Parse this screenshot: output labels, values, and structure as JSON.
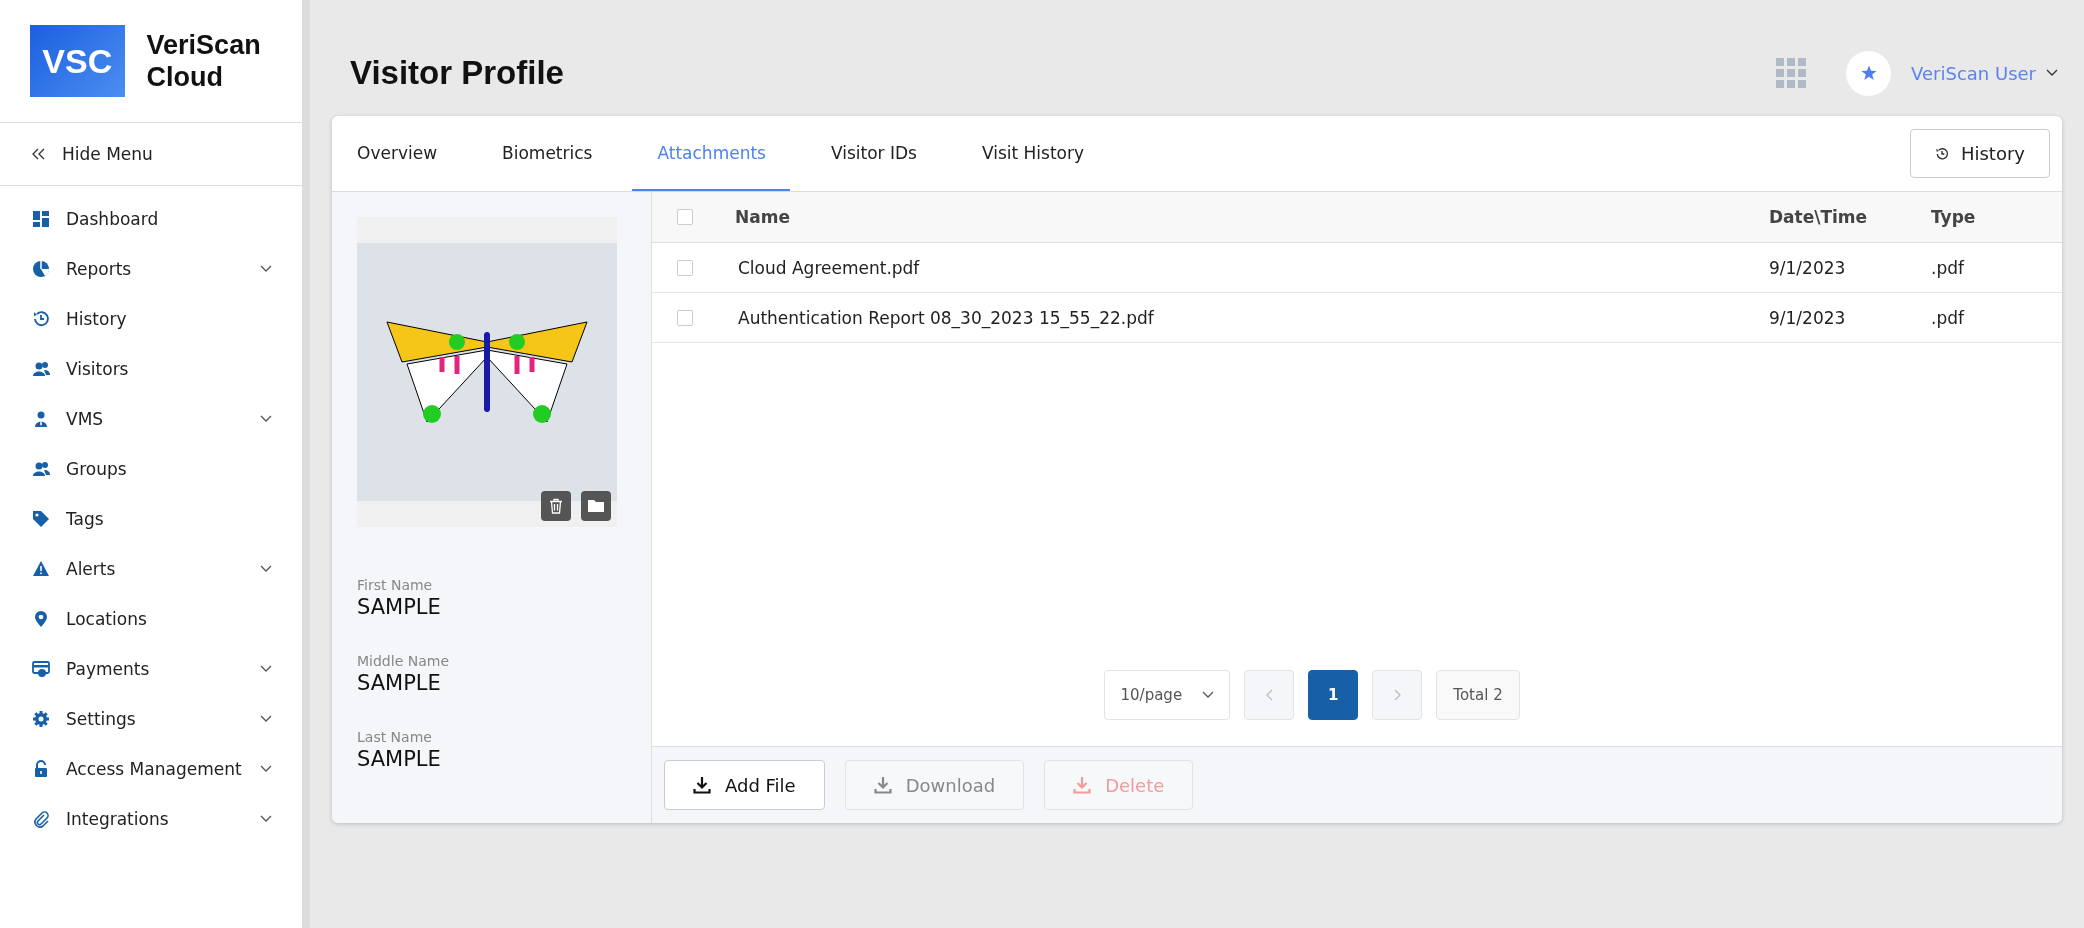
{
  "logo": {
    "mark": "VSC",
    "name": "VeriScan Cloud"
  },
  "sidebar": {
    "hide_menu": "Hide Menu",
    "items": [
      {
        "label": "Dashboard",
        "expandable": false
      },
      {
        "label": "Reports",
        "expandable": true
      },
      {
        "label": "History",
        "expandable": false
      },
      {
        "label": "Visitors",
        "expandable": false
      },
      {
        "label": "VMS",
        "expandable": true
      },
      {
        "label": "Groups",
        "expandable": false
      },
      {
        "label": "Tags",
        "expandable": false
      },
      {
        "label": "Alerts",
        "expandable": true
      },
      {
        "label": "Locations",
        "expandable": false
      },
      {
        "label": "Payments",
        "expandable": true
      },
      {
        "label": "Settings",
        "expandable": true
      },
      {
        "label": "Access Management",
        "expandable": true
      },
      {
        "label": "Integrations",
        "expandable": true
      }
    ]
  },
  "header": {
    "title": "Visitor Profile",
    "user_name": "VeriScan User"
  },
  "tabs": [
    {
      "label": "Overview",
      "selected": false
    },
    {
      "label": "Biometrics",
      "selected": false
    },
    {
      "label": "Attachments",
      "selected": true
    },
    {
      "label": "Visitor IDs",
      "selected": false
    },
    {
      "label": "Visit History",
      "selected": false
    }
  ],
  "history_button": "History",
  "profile": {
    "fields": [
      {
        "label": "First Name",
        "value": "SAMPLE"
      },
      {
        "label": "Middle Name",
        "value": "SAMPLE"
      },
      {
        "label": "Last Name",
        "value": "SAMPLE"
      }
    ]
  },
  "table": {
    "columns": [
      "Name",
      "Date\\Time",
      "Type"
    ],
    "all_checked": false,
    "rows": [
      {
        "name": "Cloud Agreement.pdf",
        "date_time": "9/1/2023",
        "type": ".pdf",
        "checked": false
      },
      {
        "name": "Authentication Report 08_30_2023 15_55_22.pdf",
        "date_time": "9/1/2023",
        "type": ".pdf",
        "checked": false
      }
    ]
  },
  "pagination": {
    "page_size": "10/page",
    "prev_disabled": true,
    "next_disabled": true,
    "pages": [
      {
        "label": "1",
        "selected": true
      }
    ],
    "total": "Total 2"
  },
  "actions": [
    {
      "label": "Add File",
      "kind": "default",
      "disabled": false
    },
    {
      "label": "Download",
      "kind": "default",
      "disabled": true
    },
    {
      "label": "Delete",
      "kind": "danger",
      "disabled": true
    }
  ]
}
